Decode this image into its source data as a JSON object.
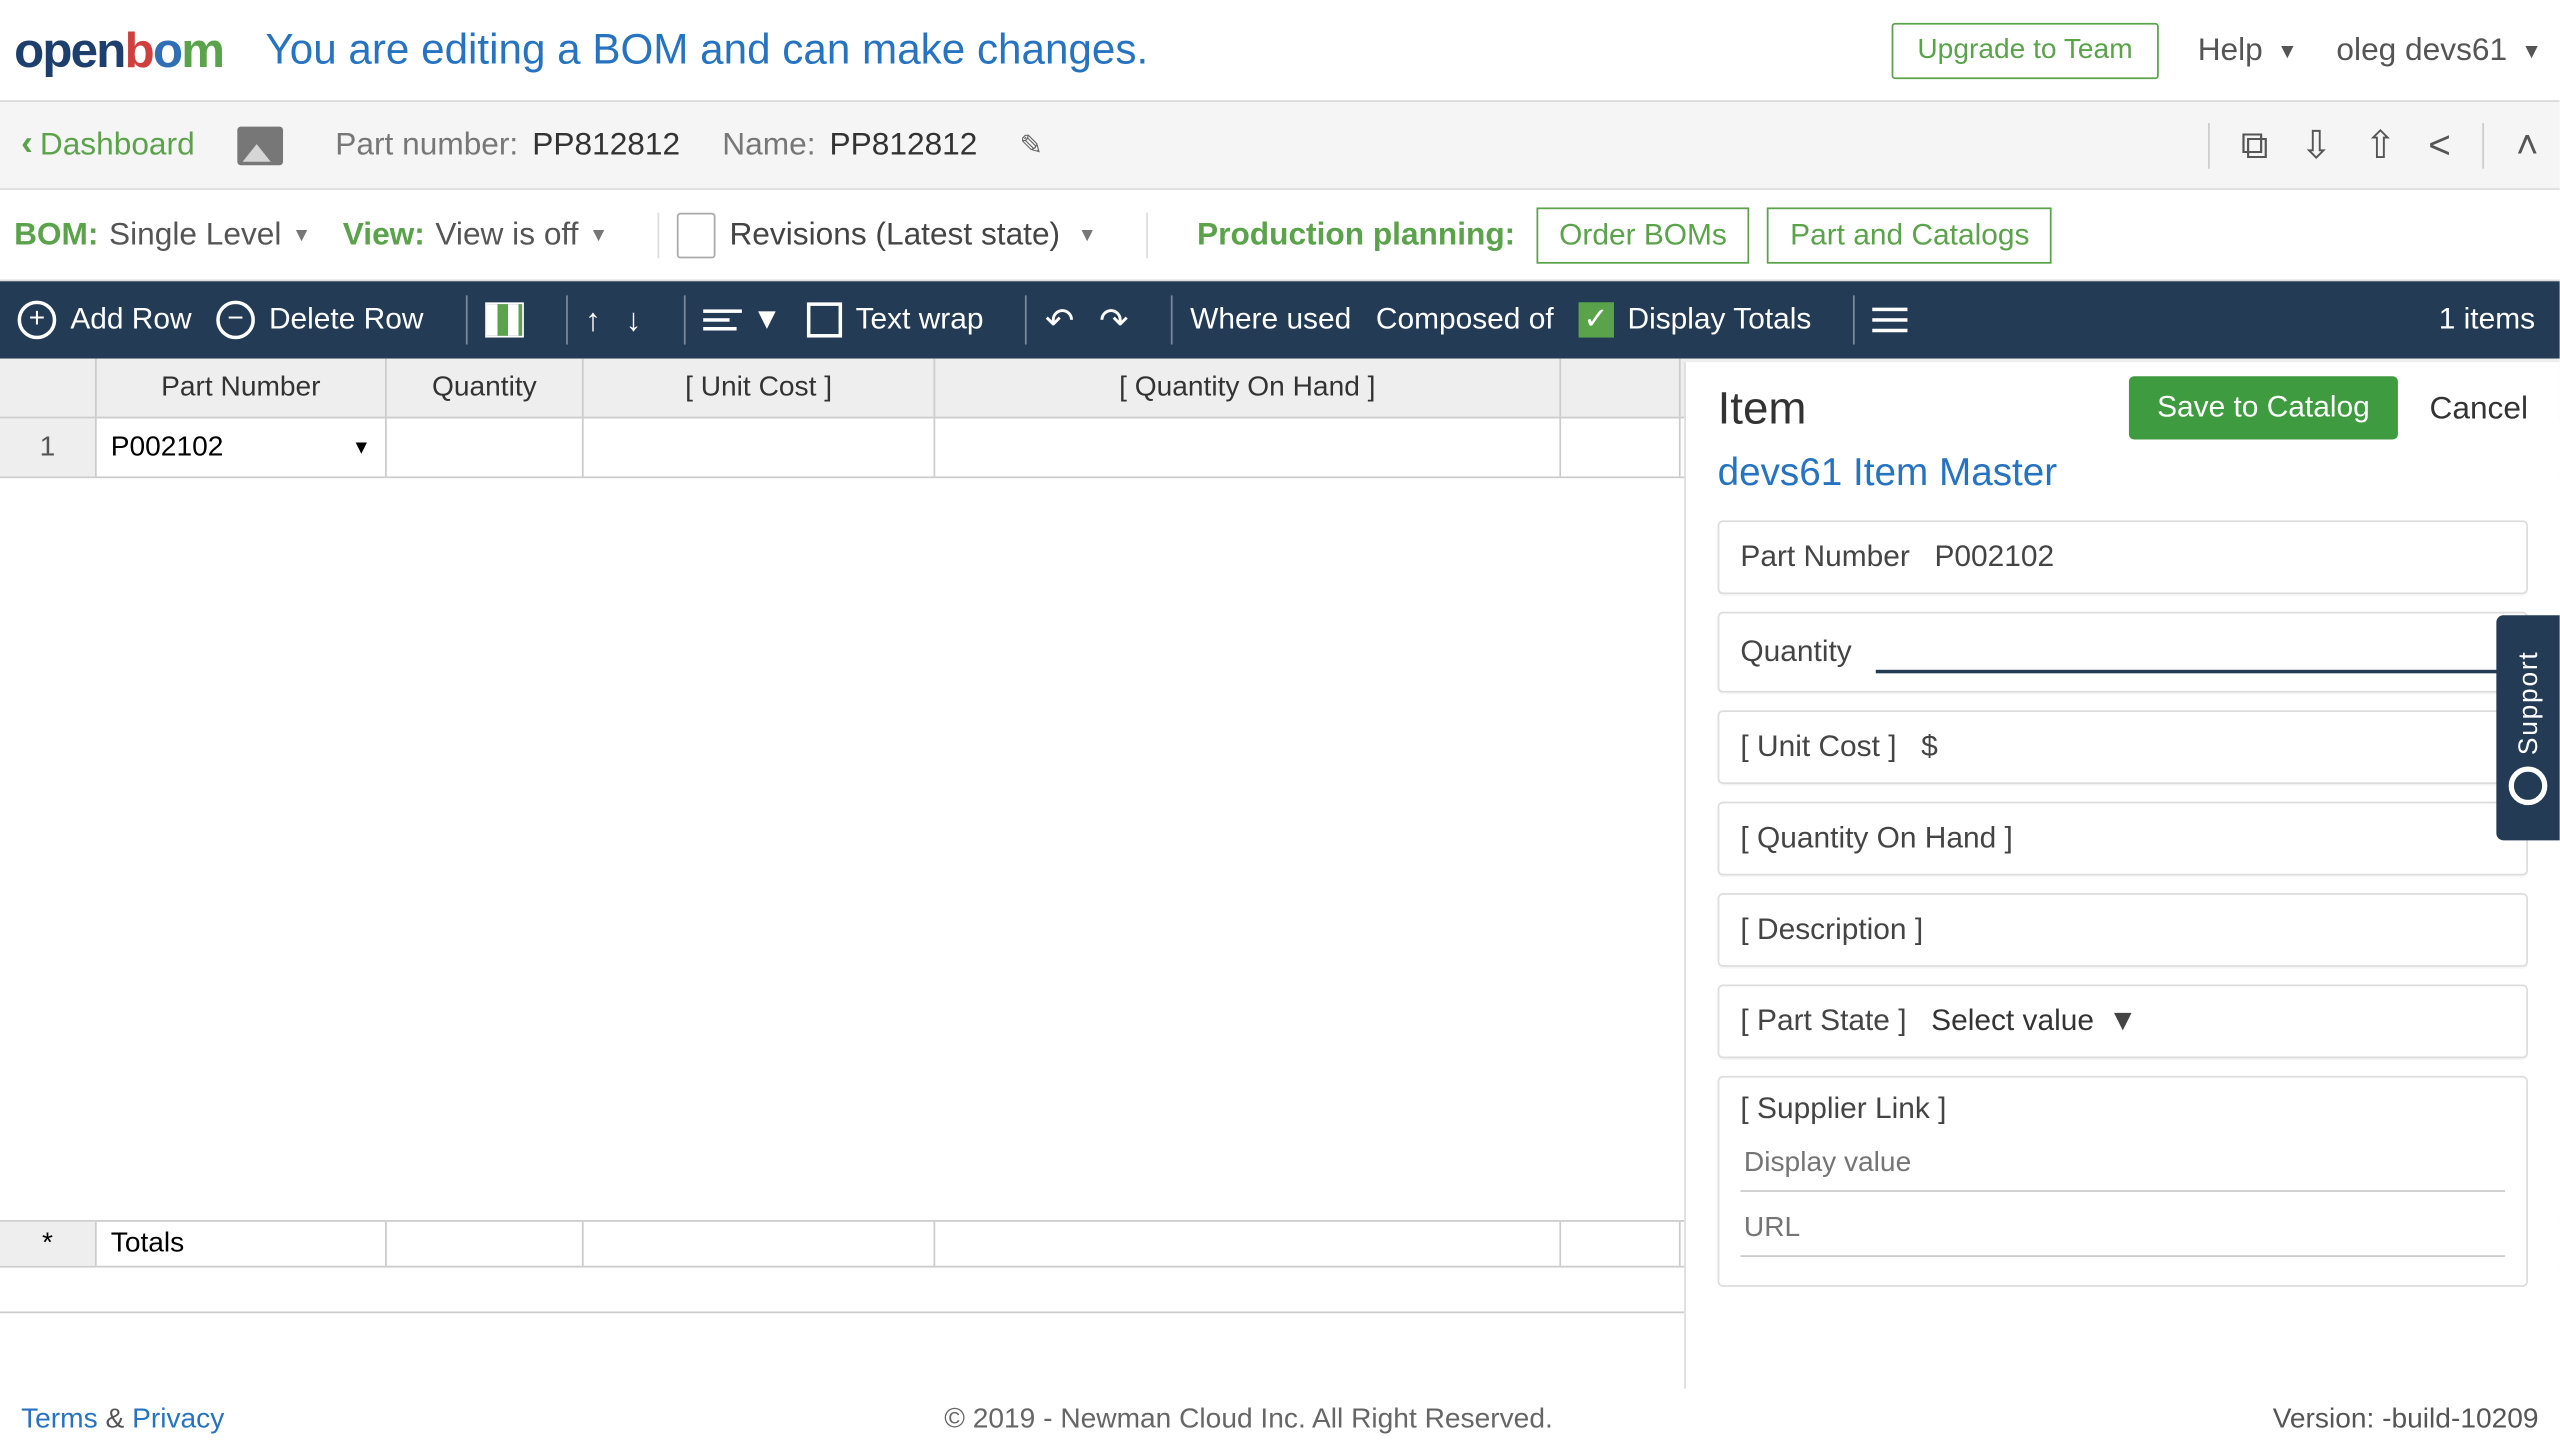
{
  "top": {
    "banner": "You are editing a BOM and can make changes.",
    "upgrade": "Upgrade to Team",
    "help": "Help",
    "user": "oleg devs61"
  },
  "partbar": {
    "back": "Dashboard",
    "pn_label": "Part number:",
    "pn_value": "PP812812",
    "name_label": "Name:",
    "name_value": "PP812812"
  },
  "viewbar": {
    "bom_label": "BOM:",
    "bom_value": "Single Level",
    "view_label": "View:",
    "view_value": "View is off",
    "revisions": "Revisions (Latest state)",
    "prod_label": "Production planning:",
    "order_boms": "Order BOMs",
    "part_catalogs": "Part and Catalogs"
  },
  "actionbar": {
    "add_row": "Add Row",
    "delete_row": "Delete Row",
    "text_wrap": "Text wrap",
    "where_used": "Where used",
    "composed_of": "Composed of",
    "display_totals": "Display Totals",
    "items_count": "1 items"
  },
  "table": {
    "headers": {
      "c1": "Part Number",
      "c2": "Quantity",
      "c3": "[ Unit Cost ]",
      "c4": "[ Quantity On Hand ]"
    },
    "rows": [
      {
        "idx": "1",
        "part_number": "P002102",
        "quantity": "",
        "unit_cost": "",
        "qoh": ""
      }
    ],
    "footer": {
      "star": "*",
      "totals": "Totals"
    }
  },
  "panel": {
    "title": "Item",
    "save": "Save to Catalog",
    "cancel": "Cancel",
    "catalog": "devs61 Item Master",
    "fields": {
      "part_number_label": "Part Number",
      "part_number_value": "P002102",
      "quantity_label": "Quantity",
      "quantity_value": "",
      "unit_cost_label": "[ Unit Cost ]",
      "unit_cost_prefix": "$",
      "qoh_label": "[ Quantity On Hand ]",
      "description_label": "[ Description ]",
      "part_state_label": "[ Part State ]",
      "part_state_value": "Select value",
      "supplier_label": "[ Supplier Link ]",
      "supplier_display_ph": "Display value",
      "supplier_url_ph": "URL"
    }
  },
  "support": "Support",
  "footer": {
    "terms": "Terms",
    "amp": " & ",
    "privacy": "Privacy",
    "copyright": "© 2019 - Newman Cloud Inc. All Right Reserved.",
    "version": "Version: -build-10209"
  }
}
